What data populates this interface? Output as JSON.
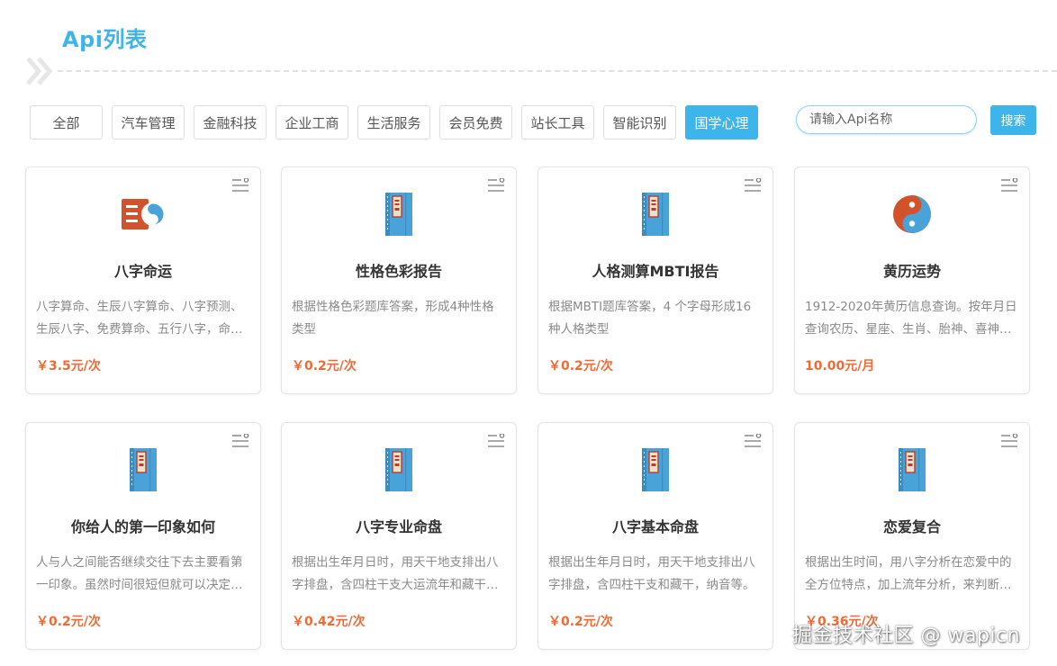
{
  "header": {
    "title": "Api列表"
  },
  "filters": [
    {
      "label": "全部",
      "active": false
    },
    {
      "label": "汽车管理",
      "active": false
    },
    {
      "label": "金融科技",
      "active": false
    },
    {
      "label": "企业工商",
      "active": false
    },
    {
      "label": "生活服务",
      "active": false
    },
    {
      "label": "会员免费",
      "active": false
    },
    {
      "label": "站长工具",
      "active": false
    },
    {
      "label": "智能识别",
      "active": false
    },
    {
      "label": "国学心理",
      "active": true
    }
  ],
  "search": {
    "placeholder": "请输入Api名称",
    "value": "",
    "button_label": "搜索"
  },
  "cards": [
    {
      "icon": "bazi-yin-yang-icon",
      "title": "八字命运",
      "desc": "八字算命、生辰八字算命、八字预测、生辰八字、免费算命、五行八字，命…",
      "price": "￥3.5元/次"
    },
    {
      "icon": "book-icon",
      "title": "性格色彩报告",
      "desc": "根据性格色彩题库答案，形成4种性格类型",
      "price": "￥0.2元/次"
    },
    {
      "icon": "book-icon",
      "title": "人格测算MBTI报告",
      "desc": "根据MBTI题库答案，4 个字母形成16种人格类型",
      "price": "￥0.2元/次"
    },
    {
      "icon": "yin-yang-icon",
      "title": "黄历运势",
      "desc": "1912-2020年黄历信息查询。按年月日查询农历、星座、生肖、胎神、喜神…",
      "price": "10.00元/月"
    },
    {
      "icon": "book-icon",
      "title": "你给人的第一印象如何",
      "desc": "人与人之间能否继续交往下去主要看第一印象。虽然时间很短但就可以决定…",
      "price": "￥0.2元/次"
    },
    {
      "icon": "book-icon",
      "title": "八字专业命盘",
      "desc": "根据出生年月日时，用天干地支排出八字排盘，含四柱干支大运流年和藏干…",
      "price": "￥0.42元/次"
    },
    {
      "icon": "book-icon",
      "title": "八字基本命盘",
      "desc": "根据出生年月日时，用天干地支排出八字排盘，含四柱干支和藏干，纳音等。",
      "price": "￥0.2元/次"
    },
    {
      "icon": "book-icon",
      "title": "恋爱复合",
      "desc": "根据出生时间，用八字分析在恋爱中的全方位特点，加上流年分析，来判断…",
      "price": "￥0.36元/次"
    }
  ],
  "watermark": "掘金技术社区 @ wapicn",
  "colors": {
    "accent": "#3db4ea",
    "price": "#f06a35",
    "book_blue": "#4aa3d8",
    "bazi_red": "#d2532b"
  }
}
